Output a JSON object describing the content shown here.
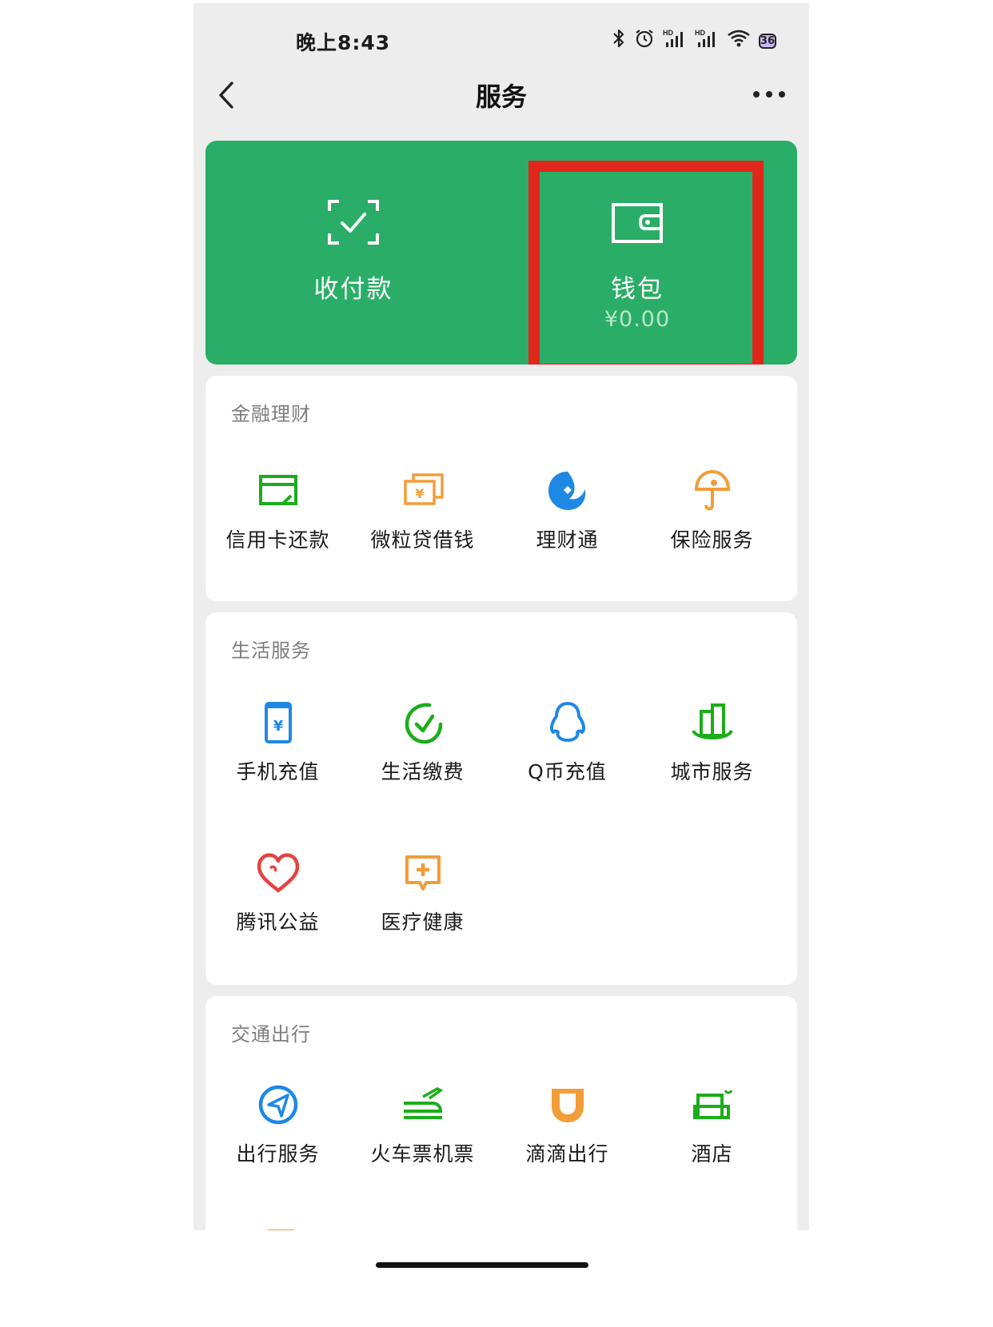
{
  "status_bar": {
    "time": "晚上8:43",
    "battery": "36",
    "signal_label": "HD"
  },
  "nav": {
    "title": "服务"
  },
  "hero": {
    "pay": {
      "label": "收付款"
    },
    "wallet": {
      "label": "钱包",
      "balance": "¥0.00"
    }
  },
  "sections": {
    "finance": {
      "title": "金融理财",
      "items": [
        {
          "label": "信用卡还款",
          "icon": "credit-card-icon",
          "color": "#1aad19"
        },
        {
          "label": "微粒贷借钱",
          "icon": "money-bills-icon",
          "color": "#f29d38"
        },
        {
          "label": "理财通",
          "icon": "licaitong-icon",
          "color": "#1e88e5"
        },
        {
          "label": "保险服务",
          "icon": "umbrella-shield-icon",
          "color": "#f29d38"
        }
      ]
    },
    "life": {
      "title": "生活服务",
      "items": [
        {
          "label": "手机充值",
          "icon": "phone-recharge-icon",
          "color": "#1e88e5"
        },
        {
          "label": "生活缴费",
          "icon": "bill-check-icon",
          "color": "#1aad19"
        },
        {
          "label": "Q币充值",
          "icon": "qq-penguin-icon",
          "color": "#1e88e5"
        },
        {
          "label": "城市服务",
          "icon": "city-building-icon",
          "color": "#1aad19"
        },
        {
          "label": "腾讯公益",
          "icon": "heart-charity-icon",
          "color": "#e64340"
        },
        {
          "label": "医疗健康",
          "icon": "medical-plus-icon",
          "color": "#f29d38"
        }
      ]
    },
    "transport": {
      "title": "交通出行",
      "items": [
        {
          "label": "出行服务",
          "icon": "navigation-arrow-icon",
          "color": "#1e88e5"
        },
        {
          "label": "火车票机票",
          "icon": "train-plane-icon",
          "color": "#1aad19"
        },
        {
          "label": "滴滴出行",
          "icon": "didi-icon",
          "color": "#f29d38"
        },
        {
          "label": "酒店",
          "icon": "hotel-bed-icon",
          "color": "#1aad19"
        }
      ]
    }
  }
}
